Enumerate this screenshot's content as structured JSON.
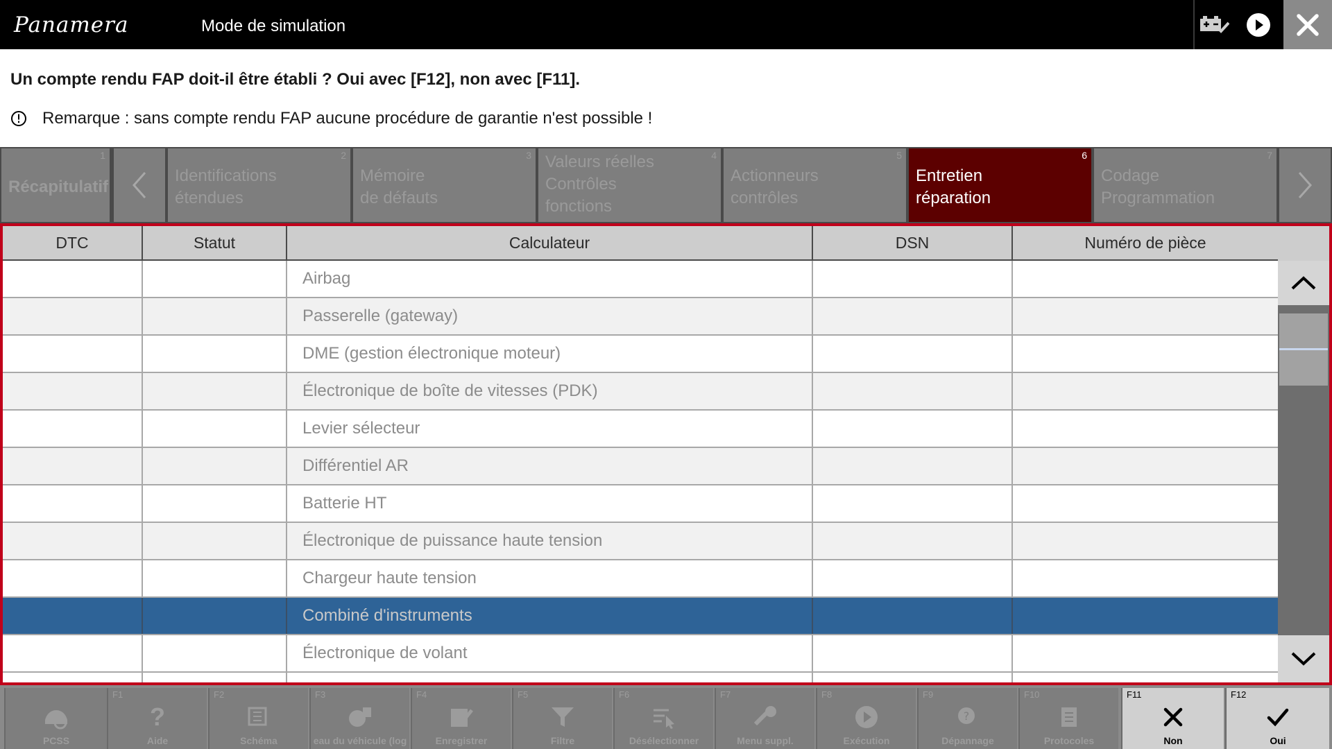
{
  "header": {
    "logo": "Panamera",
    "title": "Mode de simulation",
    "icons": [
      "battery-check-icon",
      "play-icon",
      "close-icon"
    ]
  },
  "message": {
    "question": "Un compte rendu FAP doit-il être établi ? Oui avec [F12], non avec [F11].",
    "remark": "Remarque : sans compte rendu FAP aucune procédure de garantie n'est possible !"
  },
  "tabs": [
    {
      "num": "1",
      "label": "Récapitulatif"
    },
    {
      "num": "2",
      "label": "Identifications\nétendues"
    },
    {
      "num": "3",
      "label": "Mémoire\nde défauts"
    },
    {
      "num": "4",
      "label": "Valeurs réelles\nContrôles\nfonctions"
    },
    {
      "num": "5",
      "label": "Actionneurs\ncontrôles"
    },
    {
      "num": "6",
      "label": "Entretien\nréparation",
      "active": true
    },
    {
      "num": "7",
      "label": "Codage\nProgrammation"
    }
  ],
  "table": {
    "columns": [
      "DTC",
      "Statut",
      "Calculateur",
      "DSN",
      "Numéro de pièce"
    ],
    "rows": [
      {
        "dtc": "",
        "statut": "",
        "calculateur": "Airbag",
        "dsn": "",
        "piece": ""
      },
      {
        "dtc": "",
        "statut": "",
        "calculateur": "Passerelle (gateway)",
        "dsn": "",
        "piece": ""
      },
      {
        "dtc": "",
        "statut": "",
        "calculateur": "DME (gestion électronique moteur)",
        "dsn": "",
        "piece": ""
      },
      {
        "dtc": "",
        "statut": "",
        "calculateur": "Électronique de boîte de vitesses (PDK)",
        "dsn": "",
        "piece": ""
      },
      {
        "dtc": "",
        "statut": "",
        "calculateur": "Levier sélecteur",
        "dsn": "",
        "piece": ""
      },
      {
        "dtc": "",
        "statut": "",
        "calculateur": "Différentiel AR",
        "dsn": "",
        "piece": ""
      },
      {
        "dtc": "",
        "statut": "",
        "calculateur": "Batterie HT",
        "dsn": "",
        "piece": ""
      },
      {
        "dtc": "",
        "statut": "",
        "calculateur": "Électronique de puissance haute tension",
        "dsn": "",
        "piece": ""
      },
      {
        "dtc": "",
        "statut": "",
        "calculateur": "Chargeur haute tension",
        "dsn": "",
        "piece": ""
      },
      {
        "dtc": "",
        "statut": "",
        "calculateur": "Combiné d'instruments",
        "dsn": "",
        "piece": "",
        "selected": true
      },
      {
        "dtc": "",
        "statut": "",
        "calculateur": "Électronique de volant",
        "dsn": "",
        "piece": ""
      }
    ]
  },
  "fkeys": [
    {
      "key": "",
      "label": "PCSS",
      "icon": "car-wrench-icon"
    },
    {
      "key": "F1",
      "label": "Aide",
      "icon": "help-icon"
    },
    {
      "key": "F2",
      "label": "Schéma",
      "icon": "schema-icon"
    },
    {
      "key": "F3",
      "label": "eau du véhicule (log",
      "icon": "vehicle-log-icon"
    },
    {
      "key": "F4",
      "label": "Enregistrer",
      "icon": "save-icon"
    },
    {
      "key": "F5",
      "label": "Filtre",
      "icon": "filter-icon"
    },
    {
      "key": "F6",
      "label": "Désélectionner",
      "icon": "deselect-icon"
    },
    {
      "key": "F7",
      "label": "Menu suppl.",
      "icon": "extra-menu-icon"
    },
    {
      "key": "F8",
      "label": "Exécution",
      "icon": "run-icon"
    },
    {
      "key": "F9",
      "label": "Dépannage",
      "icon": "troubleshoot-icon"
    },
    {
      "key": "F10",
      "label": "Protocoles",
      "icon": "protocol-icon"
    },
    {
      "key": "F11",
      "label": "Non",
      "icon": "x-icon",
      "active": true
    },
    {
      "key": "F12",
      "label": "Oui",
      "icon": "check-icon",
      "active": true
    }
  ]
}
